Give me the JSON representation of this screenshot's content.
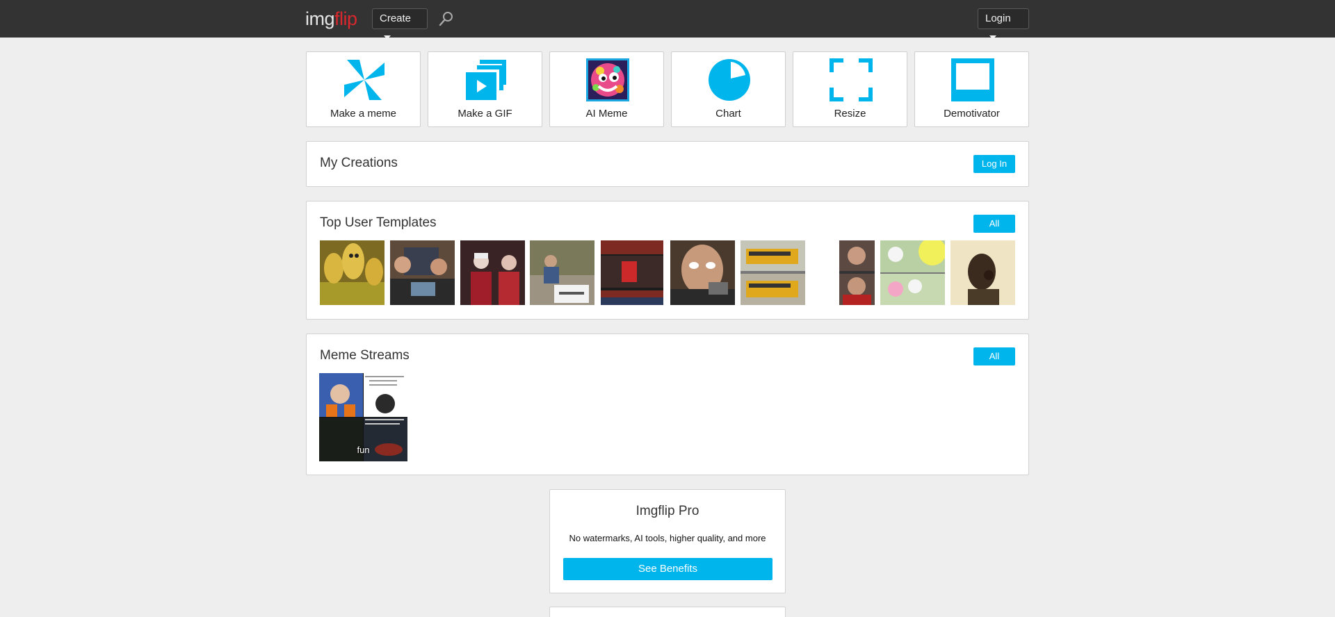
{
  "header": {
    "logo_part1": "img",
    "logo_part2": "flip",
    "create_label": "Create",
    "login_label": "Login",
    "search_icon": "search-icon"
  },
  "tools": [
    {
      "label": "Make a meme",
      "icon": "pinwheel-icon"
    },
    {
      "label": "Make a GIF",
      "icon": "gif-frames-icon"
    },
    {
      "label": "AI Meme",
      "icon": "ai-face-icon"
    },
    {
      "label": "Chart",
      "icon": "pie-chart-icon"
    },
    {
      "label": "Resize",
      "icon": "resize-corners-icon"
    },
    {
      "label": "Demotivator",
      "icon": "frame-icon"
    }
  ],
  "my_creations": {
    "title": "My Creations",
    "login_button": "Log In"
  },
  "top_templates": {
    "title": "Top User Templates",
    "all_button": "All",
    "templates": [
      "three-headed-dragon",
      "pawn-stars",
      "crowd-party",
      "change-my-mind",
      "red-dress-sequence",
      "gru-gun",
      "school-bus",
      "shocked-man",
      "ghost-cartoon",
      "laughing-man"
    ]
  },
  "meme_streams": {
    "title": "Meme Streams",
    "all_button": "All",
    "stream_label": "fun"
  },
  "pro": {
    "title": "Imgflip Pro",
    "description": "No watermarks, AI tools, higher quality, and more",
    "button": "See Benefits"
  },
  "colors": {
    "accent": "#00b5ec",
    "header_bg": "#333333",
    "logo_red": "#d9272e",
    "page_bg": "#eeeeee"
  }
}
